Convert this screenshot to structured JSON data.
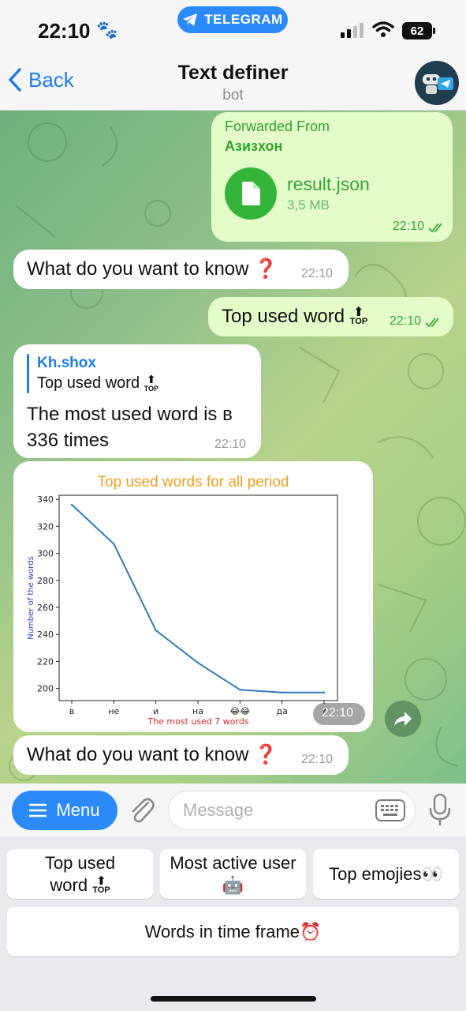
{
  "status_bar": {
    "time": "22:10",
    "paw": "🐾",
    "pill_label": "TELEGRAM",
    "battery": "62"
  },
  "header": {
    "back_label": "Back",
    "title": "Text definer",
    "subtitle": "bot"
  },
  "messages": {
    "forward": {
      "from_label": "Forwarded From",
      "from_name": "Азизхон",
      "file_name": "result.json",
      "file_size": "3,5 MB",
      "time": "22:10"
    },
    "question1": {
      "text": "What do you want to know",
      "emoji": "❓",
      "time": "22:10"
    },
    "reply_top": {
      "text": "Top used word",
      "time": "22:10"
    },
    "answer": {
      "quote_name": "Kh.shox",
      "quote_text": "Top used word",
      "text_line1": "The most used word is в",
      "text_line2": "336 times",
      "time": "22:10"
    },
    "chart_message": {
      "time": "22:10"
    },
    "question2": {
      "text": "What do you want to know",
      "emoji": "❓",
      "time": "22:10"
    }
  },
  "chart_data": {
    "type": "line",
    "title": "Top used words for all period",
    "xlabel": "The most used 7 words",
    "ylabel": "Number of the words",
    "categories": [
      "в",
      "не",
      "и",
      "на",
      "😂😂",
      "да",
      "?"
    ],
    "values": [
      336,
      307,
      243,
      219,
      199,
      197,
      197
    ],
    "yticks": [
      200,
      220,
      240,
      260,
      280,
      300,
      320,
      340
    ],
    "ylim": [
      191,
      343
    ],
    "colors": {
      "line": "#2f7ab8",
      "title": "#f0a020",
      "xlabel": "#d12b2b",
      "ylabel": "#2b3fc8"
    }
  },
  "input_bar": {
    "menu_label": "Menu",
    "placeholder": "Message"
  },
  "keyboard": {
    "btn1_line1": "Top used",
    "btn1_line2": "word",
    "btn2_line1": "Most active user",
    "btn2_emoji": "🤖",
    "btn3_label": "Top emojies",
    "btn3_emoji": "👀",
    "btn4_label": "Words in time frame",
    "btn4_emoji": "⏰"
  },
  "top_badge": "TOP",
  "colors": {
    "telegram_blue": "#2b8af7",
    "outgoing_bubble": "#e3fcc8",
    "outgoing_text": "#34a12f"
  }
}
